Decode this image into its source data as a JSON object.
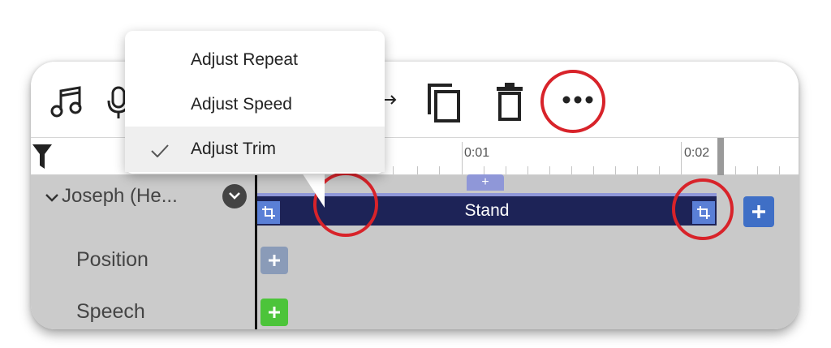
{
  "menu": {
    "items": [
      {
        "label": "Adjust Repeat",
        "checked": false
      },
      {
        "label": "Adjust Speed",
        "checked": false
      },
      {
        "label": "Adjust Trim",
        "checked": true
      }
    ]
  },
  "ruler": {
    "labels": [
      "0:01",
      "0:02"
    ]
  },
  "track": {
    "name": "Joseph (He...",
    "rows": [
      "Position",
      "Speech"
    ]
  },
  "clip": {
    "label": "Stand",
    "add_symbol": "+"
  },
  "icons": [
    "music-icon",
    "microphone-icon",
    "redo-arrow-icon",
    "duplicate-icon",
    "trash-icon",
    "more-options-icon",
    "filter-icon",
    "chevron-down-icon",
    "trim-icon",
    "plus-icon",
    "checkmark-icon"
  ],
  "colors": {
    "clip": "#1d2357",
    "clip_accent": "#8f97d8",
    "handle": "#5a7fd6",
    "highlight_ring": "#d8232a",
    "position_add": "#8a9bb8",
    "speech_add": "#4cc43a",
    "track_add": "#3f6fc6"
  }
}
